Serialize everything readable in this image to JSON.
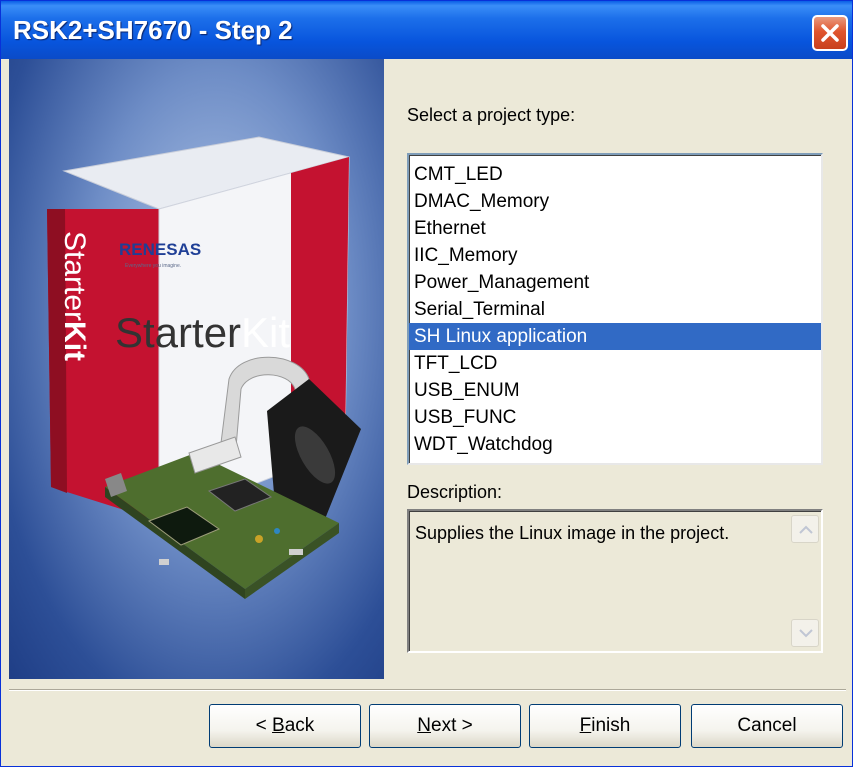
{
  "window": {
    "title": "RSK2+SH7670 - Step 2"
  },
  "product_image": {
    "brand": "RENESAS",
    "tagline": "Everywhere you imagine.",
    "kit_name_a": "Starter",
    "kit_name_b": "Kit",
    "spine_a": "Starter",
    "spine_b": "Kit"
  },
  "project_type": {
    "prompt": "Select a project type:",
    "items": [
      "CMT_LED",
      "DMAC_Memory",
      "Ethernet",
      "IIC_Memory",
      "Power_Management",
      "Serial_Terminal",
      "SH Linux application",
      "TFT_LCD",
      "USB_ENUM",
      "USB_FUNC",
      "WDT_Watchdog"
    ],
    "selected": "SH Linux application"
  },
  "description": {
    "label": "Description:",
    "text": "Supplies the Linux image in the project."
  },
  "buttons": {
    "back_prefix": "< ",
    "back_mnemonic": "B",
    "back_rest": "ack",
    "next_mnemonic": "N",
    "next_rest": "ext >",
    "finish_mnemonic": "F",
    "finish_rest": "inish",
    "cancel": "Cancel"
  },
  "colors": {
    "selection": "#316AC5",
    "titlebar": "#0855DD",
    "dialog_bg": "#ECE9D8",
    "brand_red": "#C41230"
  }
}
